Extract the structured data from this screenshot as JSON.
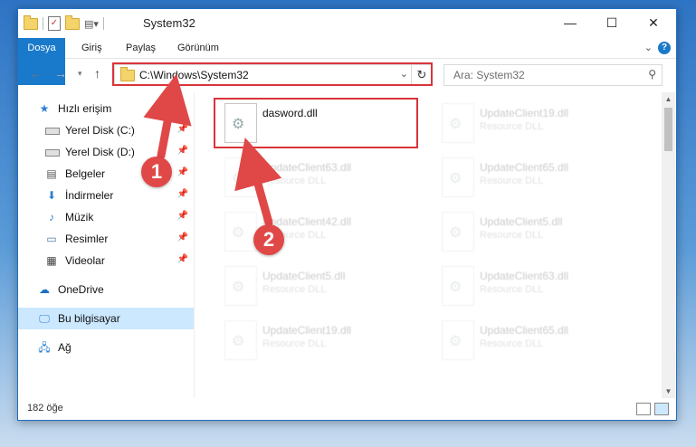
{
  "window": {
    "title": "System32",
    "minimize": "—",
    "maximize": "☐",
    "close": "✕"
  },
  "ribbon": {
    "tabs": [
      "Dosya",
      "Giriş",
      "Paylaş",
      "Görünüm"
    ],
    "help": "?"
  },
  "address": {
    "path": "C:\\Windows\\System32",
    "search_placeholder": "Ara: System32"
  },
  "nav_pane": {
    "items": [
      {
        "label": "Hızlı erişim",
        "icon": "star-icon"
      },
      {
        "label": "Yerel Disk (C:)",
        "icon": "drive-icon",
        "pinned": true
      },
      {
        "label": "Yerel Disk (D:)",
        "icon": "drive-icon",
        "pinned": true
      },
      {
        "label": "Belgeler",
        "icon": "documents-icon",
        "pinned": true
      },
      {
        "label": "İndirmeler",
        "icon": "downloads-icon",
        "pinned": true
      },
      {
        "label": "Müzik",
        "icon": "music-icon",
        "pinned": true
      },
      {
        "label": "Resimler",
        "icon": "pictures-icon",
        "pinned": true
      },
      {
        "label": "Videolar",
        "icon": "videos-icon",
        "pinned": true
      },
      {
        "label": "OneDrive",
        "icon": "cloud-icon"
      },
      {
        "label": "Bu bilgisayar",
        "icon": "computer-icon",
        "selected": true
      },
      {
        "label": "Ağ",
        "icon": "network-icon"
      }
    ]
  },
  "files": [
    {
      "name": "dasword.dll",
      "type": "",
      "highlighted": true
    },
    {
      "name": "UpdateClient19.dll",
      "type": "Resource DLL"
    },
    {
      "name": "UpdateClient63.dll",
      "type": "Resource DLL"
    },
    {
      "name": "UpdateClient65.dll",
      "type": "Resource DLL"
    },
    {
      "name": "UpdateClient42.dll",
      "type": "Resource DLL"
    },
    {
      "name": "UpdateClient5.dll",
      "type": "Resource DLL"
    },
    {
      "name": "UpdateClient5.dll",
      "type": "Resource DLL"
    },
    {
      "name": "UpdateClient63.dll",
      "type": "Resource DLL"
    },
    {
      "name": "UpdateClient19.dll",
      "type": "Resource DLL"
    },
    {
      "name": "UpdateClient65.dll",
      "type": "Resource DLL"
    }
  ],
  "status": {
    "item_count": "182 öğe"
  },
  "annotations": {
    "step1": "1",
    "step2": "2",
    "highlight_color": "#d9343a"
  }
}
